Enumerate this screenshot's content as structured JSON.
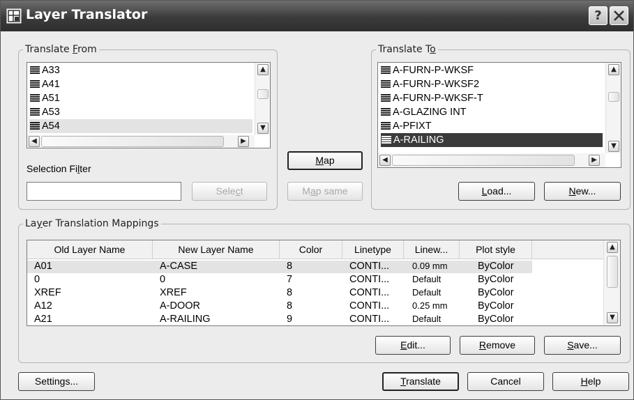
{
  "window": {
    "title": "Layer Translator",
    "help_button": "?",
    "close_button": "X"
  },
  "translate_from": {
    "legend": "Translate From",
    "items": [
      "A33",
      "A41",
      "A51",
      "A53",
      "A54"
    ],
    "selected": "A54",
    "selection_filter_label": "Selection Filter",
    "filter_value": "",
    "select_label": "Select"
  },
  "translate_to": {
    "legend": "Translate To",
    "items": [
      "A-FURN-P-WKSF",
      "A-FURN-P-WKSF2",
      "A-FURN-P-WKSF-T",
      "A-GLAZING INT",
      "A-PFIXT",
      "A-RAILING"
    ],
    "selected": "A-RAILING",
    "load_label": "Load...",
    "new_label": "New..."
  },
  "middle": {
    "map_label": "Map",
    "map_same_label": "Map same"
  },
  "mappings": {
    "legend": "Layer Translation Mappings",
    "columns": [
      "Old Layer Name",
      "New Layer Name",
      "Color",
      "Linetype",
      "Linew...",
      "Plot style"
    ],
    "rows": [
      [
        "A01",
        "A-CASE",
        "8",
        "CONTI...",
        "0.09 mm",
        "ByColor"
      ],
      [
        "0",
        "0",
        "7",
        "CONTI...",
        "Default",
        "ByColor"
      ],
      [
        "XREF",
        "XREF",
        "8",
        "CONTI...",
        "Default",
        "ByColor"
      ],
      [
        "A12",
        "A-DOOR",
        "8",
        "CONTI...",
        "0.25 mm",
        "ByColor"
      ],
      [
        "A21",
        "A-RAILING",
        "9",
        "CONTI...",
        "Default",
        "ByColor"
      ]
    ],
    "edit_label": "Edit...",
    "remove_label": "Remove",
    "save_label": "Save..."
  },
  "footer": {
    "settings_label": "Settings...",
    "translate_label": "Translate",
    "cancel_label": "Cancel",
    "help_label": "Help"
  },
  "icons": {
    "layer_icon": "layer-stack-icon",
    "scroll_up": "▲",
    "scroll_down": "▼",
    "scroll_left": "◀",
    "scroll_right": "▶"
  },
  "colors": {
    "titlebar": "#3b3b3b",
    "selection": "#3b3b3b",
    "dialog_bg": "#ececec"
  }
}
